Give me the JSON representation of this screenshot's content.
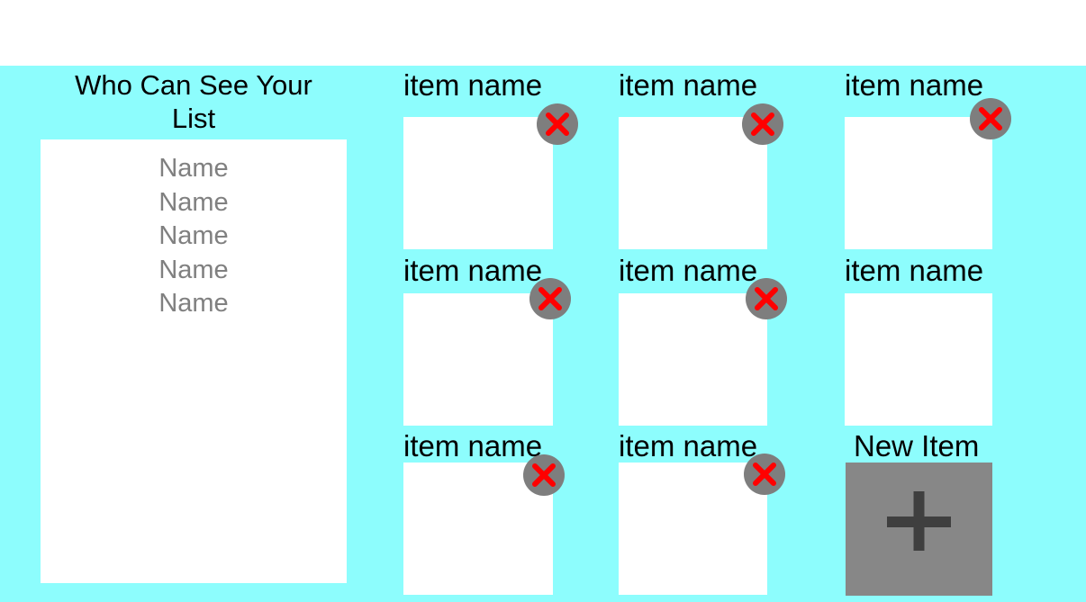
{
  "visibility": {
    "title": "Who Can See Your List",
    "names": [
      "Name",
      "Name",
      "Name",
      "Name",
      "Name"
    ]
  },
  "items": [
    {
      "label": "item name",
      "has_delete": true
    },
    {
      "label": "item name",
      "has_delete": true
    },
    {
      "label": "item name",
      "has_delete": true
    },
    {
      "label": "item name",
      "has_delete": true
    },
    {
      "label": "item name",
      "has_delete": true
    },
    {
      "label": "item name",
      "has_delete": false
    },
    {
      "label": "item name",
      "has_delete": true
    },
    {
      "label": "item name",
      "has_delete": true
    }
  ],
  "new_item": {
    "label": "New Item"
  },
  "icons": {
    "delete": "close-icon",
    "add": "plus-icon"
  },
  "colors": {
    "panel_background": "#8dfdfd",
    "delete_circle": "#7e7e7e",
    "delete_x": "#ff0000",
    "new_item_background": "#878787",
    "plus": "#3f3f3f",
    "name_text": "#808080"
  }
}
